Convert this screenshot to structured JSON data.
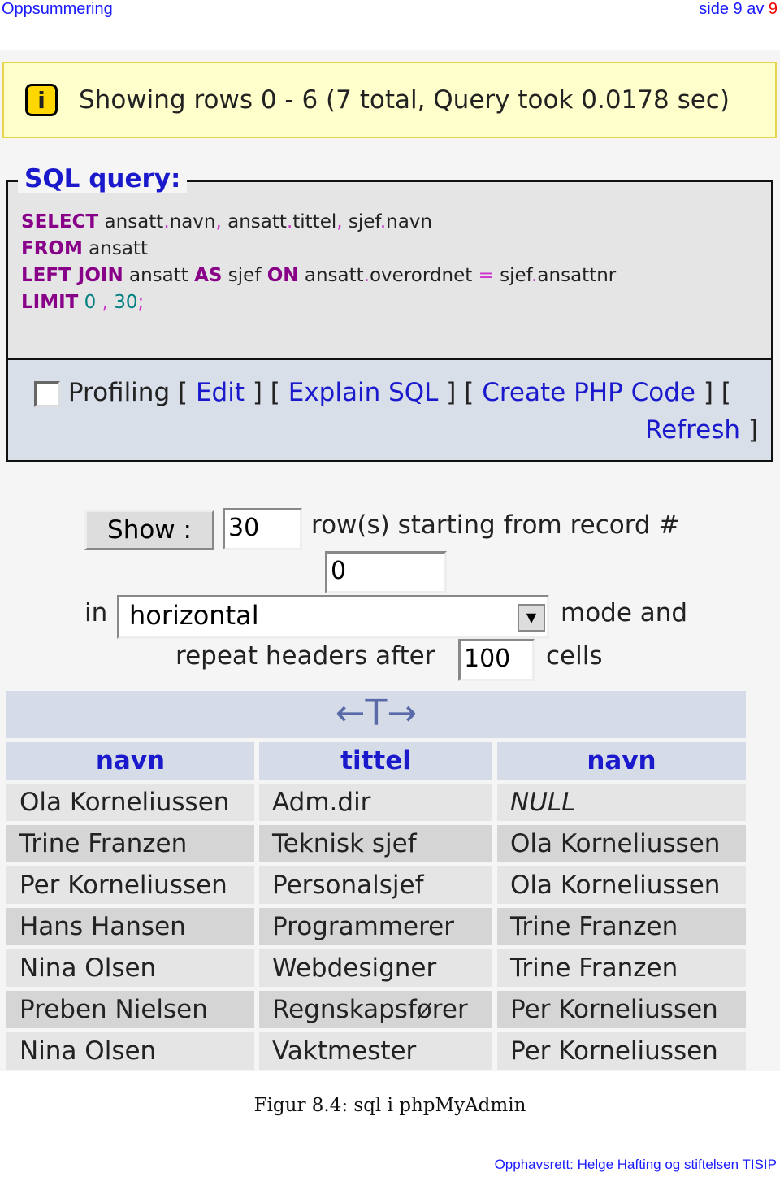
{
  "header": {
    "left": "Oppsummering",
    "right_prefix": "side 9 av ",
    "page": "9"
  },
  "info": {
    "icon": "info-icon",
    "text": "Showing rows 0 - 6 (7 total, Query took 0.0178 sec)"
  },
  "sql": {
    "legend": "SQL query:",
    "lines": [
      [
        {
          "t": "SELECT",
          "c": "kw"
        },
        {
          "t": " ansatt"
        },
        {
          "t": ".",
          "c": "pun"
        },
        {
          "t": "navn"
        },
        {
          "t": ",",
          "c": "pun"
        },
        {
          "t": " ansatt"
        },
        {
          "t": ".",
          "c": "pun"
        },
        {
          "t": "tittel"
        },
        {
          "t": ",",
          "c": "pun"
        },
        {
          "t": " sjef"
        },
        {
          "t": ".",
          "c": "pun"
        },
        {
          "t": "navn"
        }
      ],
      [
        {
          "t": "FROM",
          "c": "kw"
        },
        {
          "t": " ansatt"
        }
      ],
      [
        {
          "t": "LEFT JOIN",
          "c": "kw"
        },
        {
          "t": " ansatt "
        },
        {
          "t": "AS",
          "c": "kw"
        },
        {
          "t": " sjef "
        },
        {
          "t": "ON",
          "c": "kw"
        },
        {
          "t": " ansatt"
        },
        {
          "t": ".",
          "c": "pun"
        },
        {
          "t": "overordnet "
        },
        {
          "t": "=",
          "c": "pun"
        },
        {
          "t": " sjef"
        },
        {
          "t": ".",
          "c": "pun"
        },
        {
          "t": "ansattnr"
        }
      ],
      [
        {
          "t": "LIMIT",
          "c": "kw"
        },
        {
          "t": " 0",
          "c": "num"
        },
        {
          "t": " , ",
          "c": "pun"
        },
        {
          "t": "30",
          "c": "num"
        },
        {
          "t": ";",
          "c": "pun"
        }
      ]
    ],
    "profiling": "Profiling",
    "edit": "Edit",
    "explain": "Explain SQL",
    "php": "Create PHP Code",
    "refresh": "Refresh"
  },
  "controls": {
    "show": "Show :",
    "rows": "30",
    "rows_text": "row(s) starting from record #",
    "start": "0",
    "in": "in",
    "mode": "horizontal",
    "mode_text": "mode and",
    "repeat": "repeat headers after",
    "repeat_val": "100",
    "cells": "cells"
  },
  "table": {
    "columns": [
      "navn",
      "tittel",
      "navn"
    ],
    "rows": [
      [
        "Ola Korneliussen",
        "Adm.dir",
        "NULL"
      ],
      [
        "Trine Franzen",
        "Teknisk sjef",
        "Ola Korneliussen"
      ],
      [
        "Per Korneliussen",
        "Personalsjef",
        "Ola Korneliussen"
      ],
      [
        "Hans Hansen",
        "Programmerer",
        "Trine Franzen"
      ],
      [
        "Nina Olsen",
        "Webdesigner",
        "Trine Franzen"
      ],
      [
        "Preben Nielsen",
        "Regnskapsfører",
        "Per Korneliussen"
      ],
      [
        "Nina Olsen",
        "Vaktmester",
        "Per Korneliussen"
      ]
    ]
  },
  "caption": "Figur 8.4: sql i phpMyAdmin",
  "copyright": "Opphavsrett: Helge Hafting og stiftelsen TISIP"
}
